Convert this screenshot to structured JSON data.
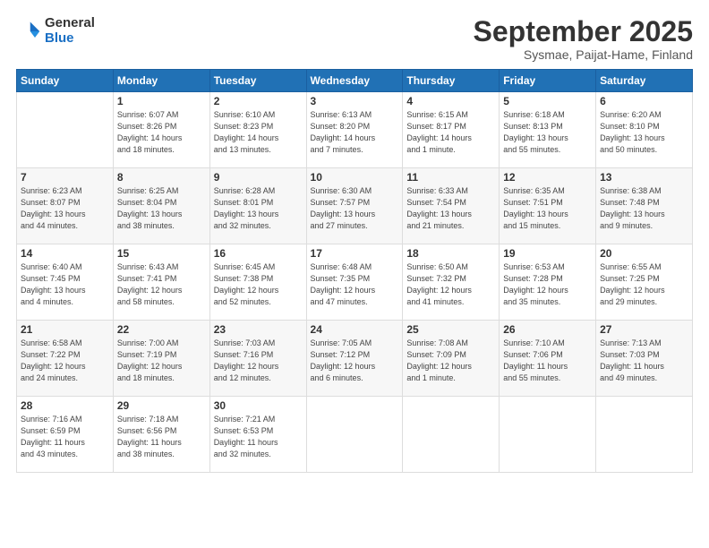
{
  "header": {
    "logo_general": "General",
    "logo_blue": "Blue",
    "title": "September 2025",
    "subtitle": "Sysmae, Paijat-Hame, Finland"
  },
  "columns": [
    "Sunday",
    "Monday",
    "Tuesday",
    "Wednesday",
    "Thursday",
    "Friday",
    "Saturday"
  ],
  "weeks": [
    [
      {
        "day": "",
        "info": ""
      },
      {
        "day": "1",
        "info": "Sunrise: 6:07 AM\nSunset: 8:26 PM\nDaylight: 14 hours\nand 18 minutes."
      },
      {
        "day": "2",
        "info": "Sunrise: 6:10 AM\nSunset: 8:23 PM\nDaylight: 14 hours\nand 13 minutes."
      },
      {
        "day": "3",
        "info": "Sunrise: 6:13 AM\nSunset: 8:20 PM\nDaylight: 14 hours\nand 7 minutes."
      },
      {
        "day": "4",
        "info": "Sunrise: 6:15 AM\nSunset: 8:17 PM\nDaylight: 14 hours\nand 1 minute."
      },
      {
        "day": "5",
        "info": "Sunrise: 6:18 AM\nSunset: 8:13 PM\nDaylight: 13 hours\nand 55 minutes."
      },
      {
        "day": "6",
        "info": "Sunrise: 6:20 AM\nSunset: 8:10 PM\nDaylight: 13 hours\nand 50 minutes."
      }
    ],
    [
      {
        "day": "7",
        "info": "Sunrise: 6:23 AM\nSunset: 8:07 PM\nDaylight: 13 hours\nand 44 minutes."
      },
      {
        "day": "8",
        "info": "Sunrise: 6:25 AM\nSunset: 8:04 PM\nDaylight: 13 hours\nand 38 minutes."
      },
      {
        "day": "9",
        "info": "Sunrise: 6:28 AM\nSunset: 8:01 PM\nDaylight: 13 hours\nand 32 minutes."
      },
      {
        "day": "10",
        "info": "Sunrise: 6:30 AM\nSunset: 7:57 PM\nDaylight: 13 hours\nand 27 minutes."
      },
      {
        "day": "11",
        "info": "Sunrise: 6:33 AM\nSunset: 7:54 PM\nDaylight: 13 hours\nand 21 minutes."
      },
      {
        "day": "12",
        "info": "Sunrise: 6:35 AM\nSunset: 7:51 PM\nDaylight: 13 hours\nand 15 minutes."
      },
      {
        "day": "13",
        "info": "Sunrise: 6:38 AM\nSunset: 7:48 PM\nDaylight: 13 hours\nand 9 minutes."
      }
    ],
    [
      {
        "day": "14",
        "info": "Sunrise: 6:40 AM\nSunset: 7:45 PM\nDaylight: 13 hours\nand 4 minutes."
      },
      {
        "day": "15",
        "info": "Sunrise: 6:43 AM\nSunset: 7:41 PM\nDaylight: 12 hours\nand 58 minutes."
      },
      {
        "day": "16",
        "info": "Sunrise: 6:45 AM\nSunset: 7:38 PM\nDaylight: 12 hours\nand 52 minutes."
      },
      {
        "day": "17",
        "info": "Sunrise: 6:48 AM\nSunset: 7:35 PM\nDaylight: 12 hours\nand 47 minutes."
      },
      {
        "day": "18",
        "info": "Sunrise: 6:50 AM\nSunset: 7:32 PM\nDaylight: 12 hours\nand 41 minutes."
      },
      {
        "day": "19",
        "info": "Sunrise: 6:53 AM\nSunset: 7:28 PM\nDaylight: 12 hours\nand 35 minutes."
      },
      {
        "day": "20",
        "info": "Sunrise: 6:55 AM\nSunset: 7:25 PM\nDaylight: 12 hours\nand 29 minutes."
      }
    ],
    [
      {
        "day": "21",
        "info": "Sunrise: 6:58 AM\nSunset: 7:22 PM\nDaylight: 12 hours\nand 24 minutes."
      },
      {
        "day": "22",
        "info": "Sunrise: 7:00 AM\nSunset: 7:19 PM\nDaylight: 12 hours\nand 18 minutes."
      },
      {
        "day": "23",
        "info": "Sunrise: 7:03 AM\nSunset: 7:16 PM\nDaylight: 12 hours\nand 12 minutes."
      },
      {
        "day": "24",
        "info": "Sunrise: 7:05 AM\nSunset: 7:12 PM\nDaylight: 12 hours\nand 6 minutes."
      },
      {
        "day": "25",
        "info": "Sunrise: 7:08 AM\nSunset: 7:09 PM\nDaylight: 12 hours\nand 1 minute."
      },
      {
        "day": "26",
        "info": "Sunrise: 7:10 AM\nSunset: 7:06 PM\nDaylight: 11 hours\nand 55 minutes."
      },
      {
        "day": "27",
        "info": "Sunrise: 7:13 AM\nSunset: 7:03 PM\nDaylight: 11 hours\nand 49 minutes."
      }
    ],
    [
      {
        "day": "28",
        "info": "Sunrise: 7:16 AM\nSunset: 6:59 PM\nDaylight: 11 hours\nand 43 minutes."
      },
      {
        "day": "29",
        "info": "Sunrise: 7:18 AM\nSunset: 6:56 PM\nDaylight: 11 hours\nand 38 minutes."
      },
      {
        "day": "30",
        "info": "Sunrise: 7:21 AM\nSunset: 6:53 PM\nDaylight: 11 hours\nand 32 minutes."
      },
      {
        "day": "",
        "info": ""
      },
      {
        "day": "",
        "info": ""
      },
      {
        "day": "",
        "info": ""
      },
      {
        "day": "",
        "info": ""
      }
    ]
  ]
}
